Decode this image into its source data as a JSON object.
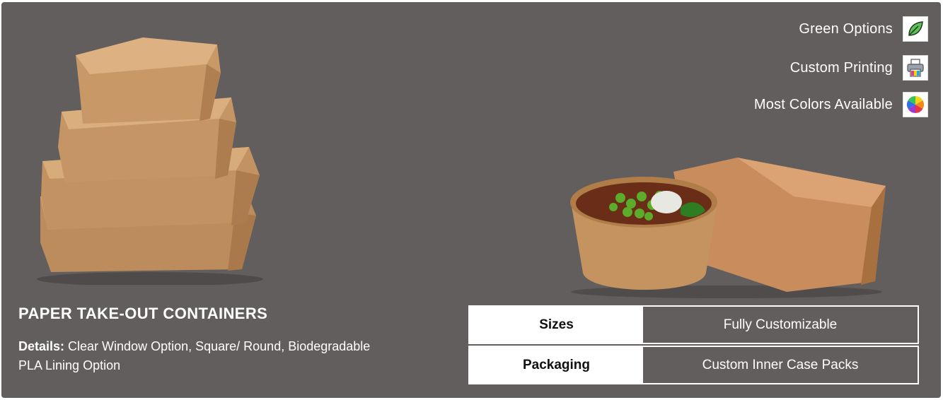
{
  "features": [
    {
      "label": "Green Options",
      "icon": "leaf-icon"
    },
    {
      "label": "Custom Printing",
      "icon": "printer-icon"
    },
    {
      "label": "Most Colors Available",
      "icon": "color-wheel-icon"
    }
  ],
  "product": {
    "title": "PAPER TAKE-OUT CONTAINERS",
    "details_label": "Details:",
    "details_text": "Clear Window Option, Square/ Round, Biodegradable PLA Lining Option"
  },
  "specs": [
    {
      "key": "Sizes",
      "value": "Fully Customizable"
    },
    {
      "key": "Packaging",
      "value": "Custom Inner Case Packs"
    }
  ],
  "colors": {
    "panel": "#625e5d",
    "kraft": "#c79a6a",
    "text": "#ffffff"
  }
}
